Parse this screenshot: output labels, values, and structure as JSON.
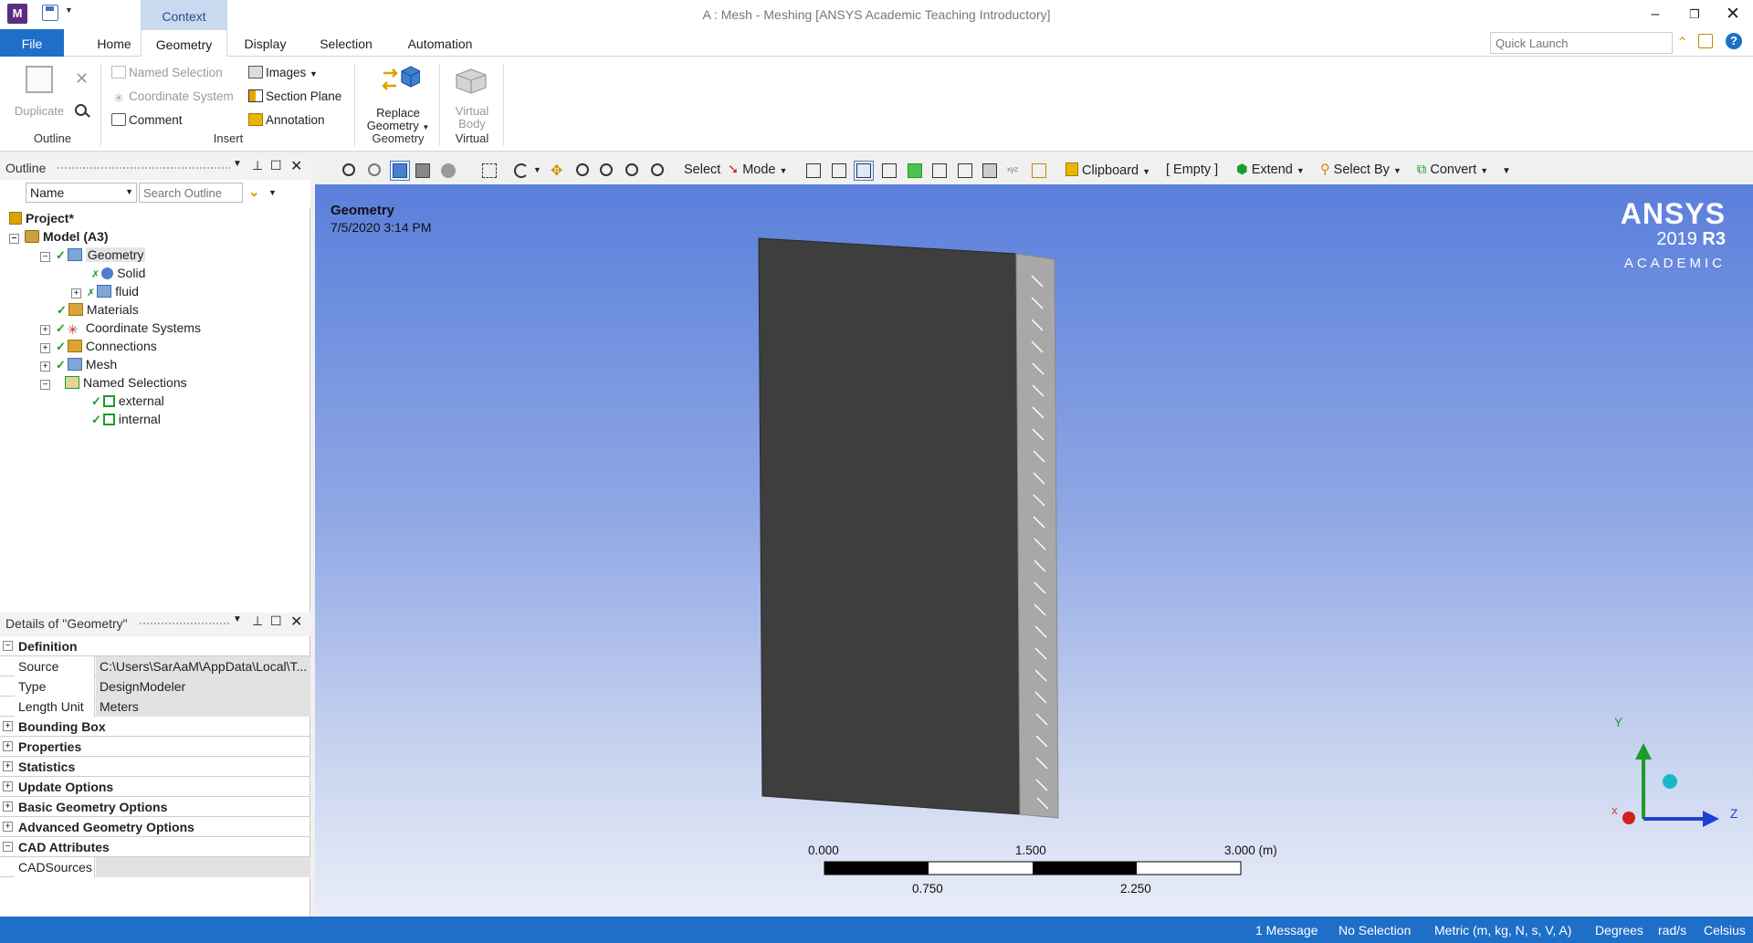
{
  "window": {
    "app_icon": "M",
    "context_tab": "Context",
    "title": "A : Mesh - Meshing [ANSYS Academic Teaching Introductory]"
  },
  "tabs": {
    "file": "File",
    "home": "Home",
    "geometry": "Geometry",
    "display": "Display",
    "selection": "Selection",
    "automation": "Automation"
  },
  "quick_launch": {
    "placeholder": "Quick Launch"
  },
  "ribbon": {
    "outline": {
      "duplicate": "Duplicate",
      "group": "Outline"
    },
    "insert": {
      "named_selection": "Named Selection",
      "coordinate_system": "Coordinate System",
      "comment": "Comment",
      "images": "Images",
      "section_plane": "Section Plane",
      "annotation": "Annotation",
      "group": "Insert"
    },
    "geometry": {
      "replace_1": "Replace",
      "replace_2": "Geometry",
      "group": "Geometry"
    },
    "virtual": {
      "vb_1": "Virtual",
      "vb_2": "Body",
      "group": "Virtual"
    }
  },
  "outline_panel": {
    "title": "Outline",
    "filter": "Name",
    "search_placeholder": "Search Outline",
    "tree": {
      "project": "Project*",
      "model": "Model (A3)",
      "geometry": "Geometry",
      "solid": "Solid",
      "fluid": "fluid",
      "materials": "Materials",
      "coordinate_systems": "Coordinate Systems",
      "connections": "Connections",
      "mesh": "Mesh",
      "named_selections": "Named Selections",
      "external": "external",
      "internal": "internal"
    }
  },
  "details_panel": {
    "title": "Details of \"Geometry\"",
    "definition": "Definition",
    "rows": [
      {
        "key": "Source",
        "value": "C:\\Users\\SarAaM\\AppData\\Local\\T..."
      },
      {
        "key": "Type",
        "value": "DesignModeler"
      },
      {
        "key": "Length Unit",
        "value": "Meters"
      }
    ],
    "categories": [
      "Bounding Box",
      "Properties",
      "Statistics",
      "Update Options",
      "Basic Geometry Options",
      "Advanced Geometry Options"
    ],
    "cad_attributes": "CAD Attributes",
    "cad_sources_key": "CADSources",
    "cad_sources_value": ""
  },
  "viewport_toolbar": {
    "select": "Select",
    "mode": "Mode",
    "clipboard": "Clipboard",
    "empty": "[ Empty ]",
    "extend": "Extend",
    "select_by": "Select By",
    "convert": "Convert"
  },
  "viewport": {
    "title": "Geometry",
    "date": "7/5/2020 3:14 PM",
    "logo_1": "ANSYS",
    "logo_2a": "2019 ",
    "logo_2b": "R3",
    "logo_3": "ACADEMIC",
    "scale": {
      "top_0": "0.000",
      "top_1": "1.500",
      "top_2": "3.000 (m)",
      "bot_1": "0.750",
      "bot_2": "2.250"
    },
    "axes": {
      "y": "Y",
      "z": "Z",
      "x": "X"
    }
  },
  "status_bar": {
    "messages": "1 Message",
    "selection": "No Selection",
    "units": "Metric (m, kg, N, s, V, A)",
    "angle": "Degrees",
    "rate": "rad/s",
    "temp": "Celsius"
  },
  "colors": {
    "accent": "#1e6fc8",
    "context": "#c9d9ef",
    "model_body": "#3e3e3e",
    "check": "#1c9b2a"
  }
}
